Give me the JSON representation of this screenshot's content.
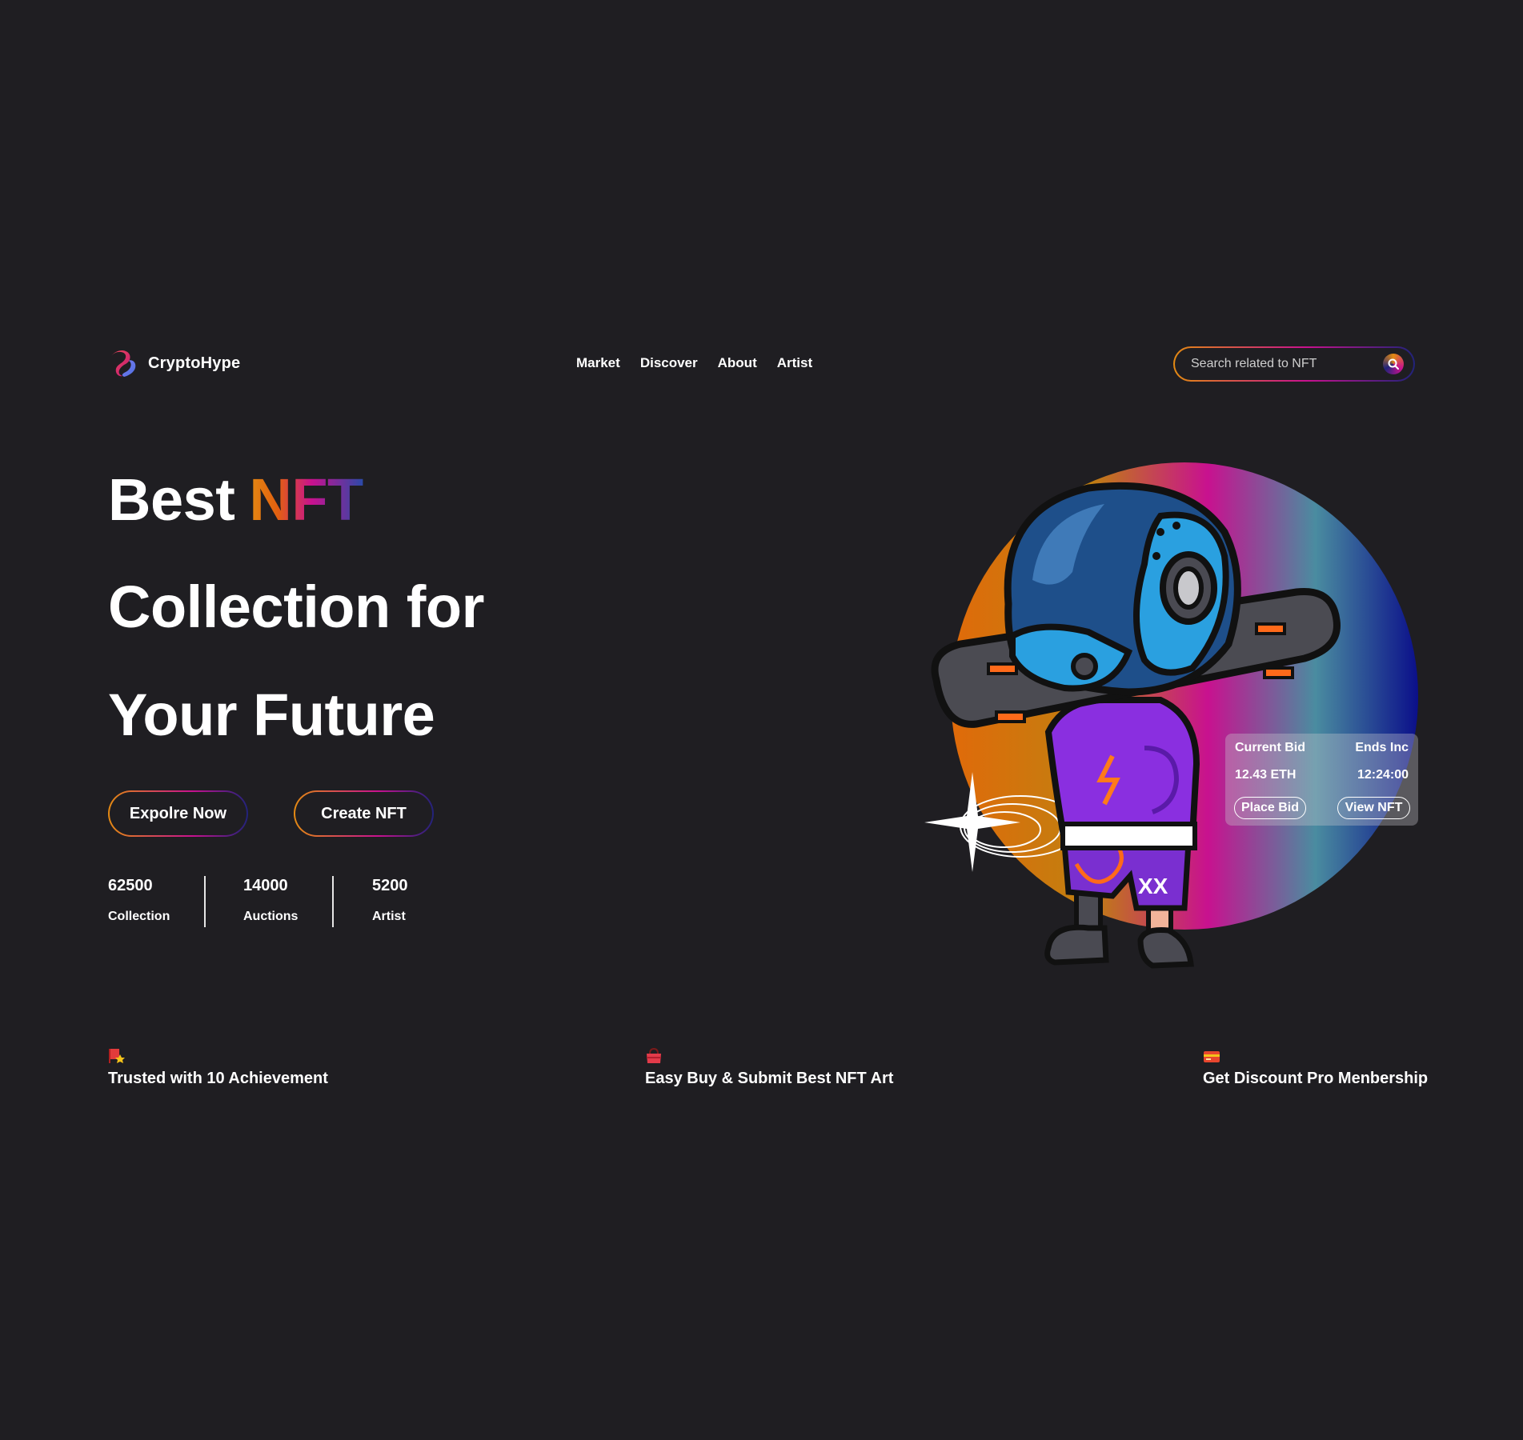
{
  "header": {
    "brand": "CryptoHype",
    "nav": [
      "Market",
      "Discover",
      "About",
      "Artist"
    ],
    "search": {
      "placeholder": "Search related to NFT"
    }
  },
  "hero": {
    "line1_a": "Best",
    "line1_b": "NFT",
    "line2": "Collection for",
    "line3": "Your Future",
    "buttons": {
      "explore": "Expolre Now",
      "create": "Create NFT"
    }
  },
  "stats": [
    {
      "value": "62500",
      "label": "Collection"
    },
    {
      "value": "14000",
      "label": "Auctions"
    },
    {
      "value": "5200",
      "label": "Artist"
    }
  ],
  "bid_card": {
    "bid_label": "Current Bid",
    "bid_value": "12.43 ETH",
    "ends_label": "Ends Inc",
    "ends_value": "12:24:00",
    "place_bid": "Place Bid",
    "view_nft": "View NFT"
  },
  "features": [
    {
      "icon": "trophy-flag-icon",
      "text": "Trusted with 10 Achievement"
    },
    {
      "icon": "shopping-bag-icon",
      "text": "Easy Buy & Submit Best NFT Art"
    },
    {
      "icon": "discount-card-icon",
      "text": "Get Discount Pro Menbership"
    }
  ],
  "colors": {
    "background": "#1f1e22",
    "accent_orange": "#e38a12",
    "accent_magenta": "#c8118f",
    "accent_navy": "#21237a"
  }
}
